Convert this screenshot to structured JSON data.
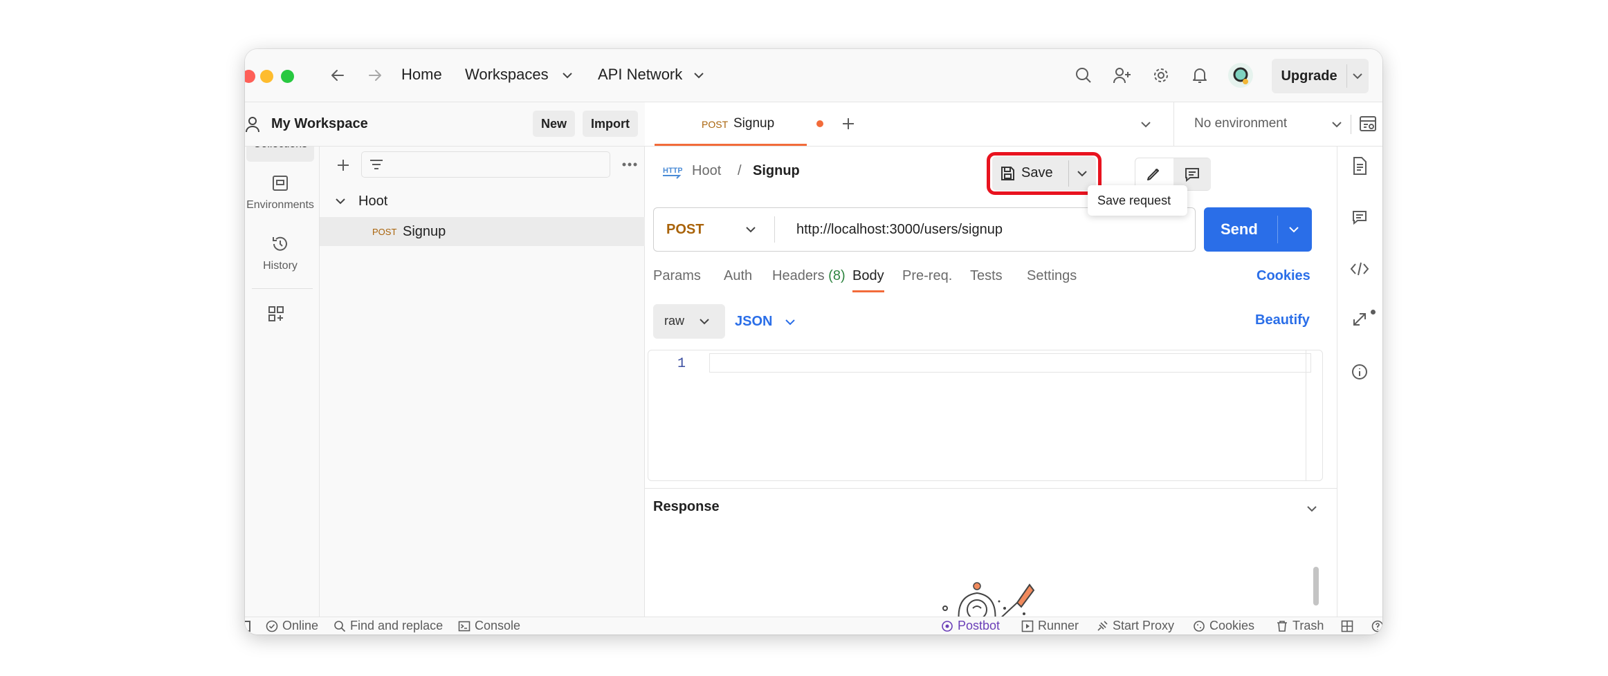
{
  "nav": {
    "home": "Home",
    "workspaces": "Workspaces",
    "api_network": "API Network",
    "upgrade": "Upgrade"
  },
  "workspace": {
    "title": "My Workspace",
    "new": "New",
    "import": "Import"
  },
  "sidebar": {
    "items": [
      {
        "label": "Collections",
        "icon": "collections-icon"
      },
      {
        "label": "Environments",
        "icon": "environments-icon"
      },
      {
        "label": "History",
        "icon": "history-icon"
      }
    ]
  },
  "tree": {
    "collection": "Hoot",
    "request_method": "POST",
    "request_name": "Signup"
  },
  "tab": {
    "method": "POST",
    "name": "Signup",
    "environment": "No environment"
  },
  "request": {
    "breadcrumb_collection": "Hoot",
    "breadcrumb_sep": "/",
    "breadcrumb_name": "Signup",
    "save": "Save",
    "save_tooltip": "Save request",
    "method": "POST",
    "url": "http://localhost:3000/users/signup",
    "send": "Send",
    "tabs": [
      "Params",
      "Auth",
      "Headers",
      "Body",
      "Pre-req.",
      "Tests",
      "Settings"
    ],
    "headers_count": "(8)",
    "cookies": "Cookies",
    "body_mode": "raw",
    "body_lang": "JSON",
    "beautify": "Beautify",
    "line_number": "1"
  },
  "response": {
    "title": "Response"
  },
  "status": {
    "online": "Online",
    "find_replace": "Find and replace",
    "console": "Console",
    "postbot": "Postbot",
    "runner": "Runner",
    "start_proxy": "Start Proxy",
    "cookies": "Cookies",
    "trash": "Trash"
  },
  "colors": {
    "accent": "#2a6ee8",
    "post": "#a9630a",
    "highlight": "#e8131f",
    "unsaved_dot": "#f26b3a",
    "postbot": "#6b3fb8"
  }
}
